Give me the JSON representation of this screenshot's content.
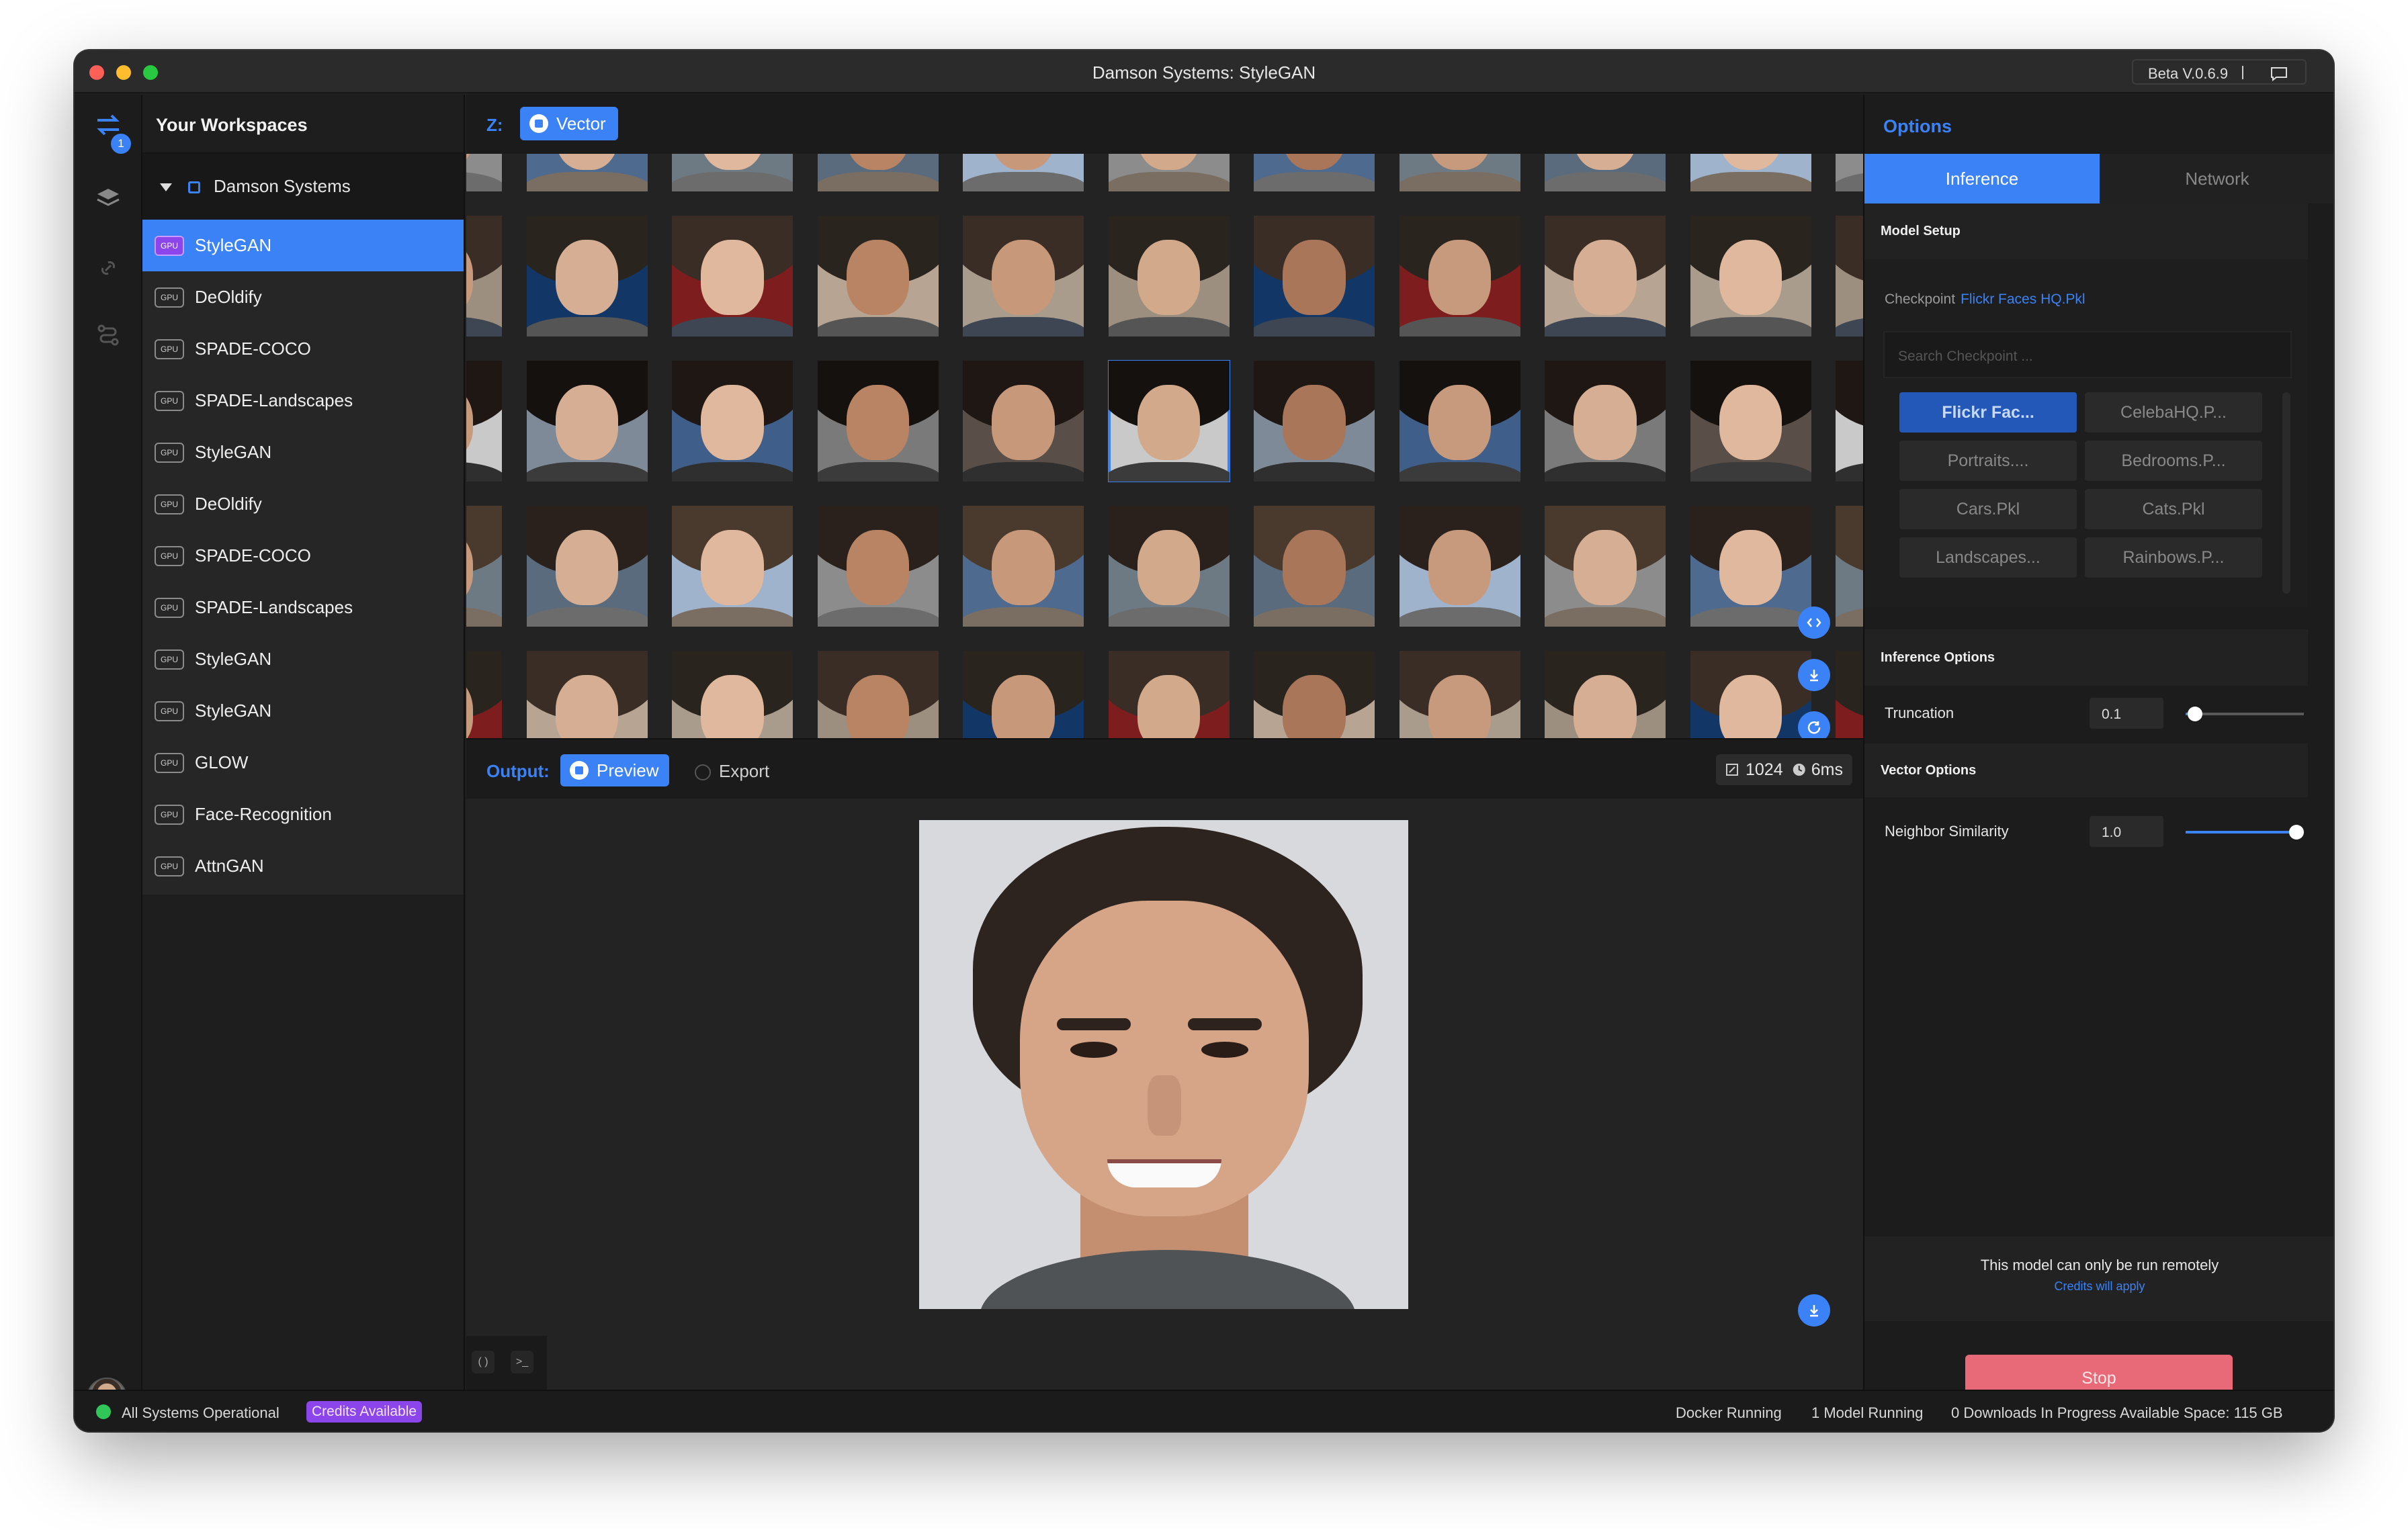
{
  "window": {
    "title": "Damson Systems: StyleGAN",
    "version": "Beta V.0.6.9"
  },
  "rail": {
    "badge": "1"
  },
  "workspaces": {
    "title": "Your Workspaces",
    "group": "Damson Systems",
    "gpu_tag": "GPU",
    "items": [
      {
        "label": "StyleGAN",
        "selected": true
      },
      {
        "label": "DeOldify"
      },
      {
        "label": "SPADE-COCO"
      },
      {
        "label": "SPADE-Landscapes"
      },
      {
        "label": "StyleGAN"
      },
      {
        "label": "DeOldify"
      },
      {
        "label": "SPADE-COCO"
      },
      {
        "label": "SPADE-Landscapes"
      },
      {
        "label": "StyleGAN"
      },
      {
        "label": "StyleGAN"
      },
      {
        "label": "GLOW"
      },
      {
        "label": "Face-Recognition"
      },
      {
        "label": "AttnGAN"
      }
    ]
  },
  "ztoolbar": {
    "label": "Z:",
    "vector_label": "Vector"
  },
  "grid": {
    "rows": 5,
    "cols": 11,
    "selected": [
      2,
      5
    ]
  },
  "output": {
    "label": "Output:",
    "preview_label": "Preview",
    "export_label": "Export",
    "resolution": "1024x1024",
    "latency": "6ms"
  },
  "options": {
    "title": "Options",
    "tabs": [
      "Inference",
      "Network"
    ],
    "active_tab": "Inference",
    "model_setup": "Model Setup",
    "checkpoint_label": "Checkpoint",
    "checkpoint_value": "Flickr Faces HQ.Pkl",
    "search_placeholder": "Search Checkpoint ...",
    "checkpoints": [
      "Flickr Fac...",
      "CelebaHQ.P...",
      "Portraits....",
      "Bedrooms.P...",
      "Cars.Pkl",
      "Cats.Pkl",
      "Landscapes...",
      "Rainbows.P..."
    ],
    "inference_options": "Inference Options",
    "truncation_label": "Truncation",
    "truncation_value": "0.1",
    "vector_options": "Vector Options",
    "similarity_label": "Neighbor Similarity",
    "similarity_value": "1.0",
    "remote_note": "This model can only be run remotely",
    "credits_note": "Credits will apply",
    "stop_label": "Stop"
  },
  "status": {
    "systems": "All Systems Operational",
    "credits": "Credits Available",
    "docker": "Docker Running",
    "models": "1 Model Running",
    "downloads": "0 Downloads In Progress",
    "space": "Available Space: 115 GB"
  },
  "colors": {
    "accent": "#3b82f6",
    "gpu_selected": "#8b45ea",
    "stop": "#e86a78",
    "status_ok": "#31c65a"
  }
}
